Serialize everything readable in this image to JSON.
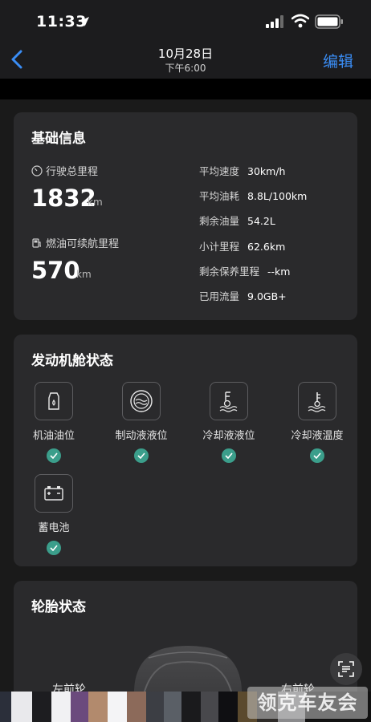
{
  "status_bar": {
    "time": "11:33"
  },
  "nav": {
    "title": "10月28日",
    "subtitle": "下午6:00",
    "edit_label": "编辑"
  },
  "basic_info": {
    "title": "基础信息",
    "odometer": {
      "label": "行驶总里程",
      "value": "1832",
      "unit": "km"
    },
    "range": {
      "label": "燃油可续航里程",
      "value": "570",
      "unit": "km"
    },
    "stats": [
      {
        "label": "平均速度",
        "value": "30km/h"
      },
      {
        "label": "平均油耗",
        "value": "8.8L/100km"
      },
      {
        "label": "剩余油量",
        "value": "54.2L"
      },
      {
        "label": "小计里程",
        "value": "62.6km"
      },
      {
        "label": "剩余保养里程",
        "value": "--km"
      },
      {
        "label": "已用流量",
        "value": "9.0GB+"
      }
    ]
  },
  "engine_status": {
    "title": "发动机舱状态",
    "items": [
      {
        "label": "机油油位",
        "icon": "oil-level-icon",
        "ok": true
      },
      {
        "label": "制动液液位",
        "icon": "brake-fluid-icon",
        "ok": true
      },
      {
        "label": "冷却液液位",
        "icon": "coolant-level-icon",
        "ok": true
      },
      {
        "label": "冷却液温度",
        "icon": "coolant-temp-icon",
        "ok": true
      },
      {
        "label": "蓄电池",
        "icon": "battery-icon",
        "ok": true
      }
    ]
  },
  "tire_status": {
    "title": "轮胎状态",
    "front_left_label": "左前轮",
    "front_right_label": "右前轮"
  },
  "watermark_text": "领克车友会",
  "colors": {
    "accent": "#3a8df5",
    "ok": "#3b9e8b",
    "card": "#2a2a2c",
    "background": "#1a1a1a"
  }
}
